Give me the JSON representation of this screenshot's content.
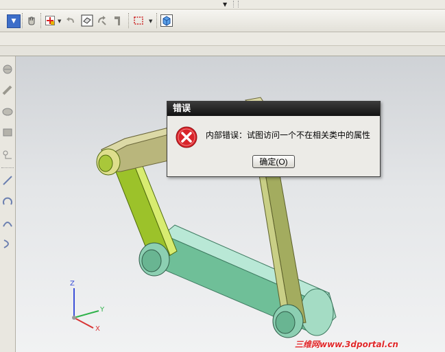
{
  "dialog": {
    "title": "错误",
    "message": "内部错误：试图访问一个不在相关类中的属性",
    "ok_label": "确定(O)",
    "icon": "error-icon"
  },
  "axis_triad": {
    "x": "X",
    "y": "Y",
    "z": "Z"
  },
  "watermark": "三维网www.3dportal.cn",
  "toolbar": {
    "icons": [
      "dropdown-arrow-icon",
      "hand-icon",
      "snap-point-icon",
      "undo-icon",
      "select-face-icon",
      "rotate-icon",
      "hammer-icon",
      "selection-box-icon",
      "view-cube-icon"
    ]
  },
  "colors": {
    "dialog_title_bg": "#1e1e1e",
    "error_red": "#d9242a",
    "link_green": "#9cc22a",
    "link_olive": "#a3ac5f",
    "link_khaki": "#b9b67c",
    "base_teal": "#7fcaa7",
    "watermark": "#e0282a"
  }
}
